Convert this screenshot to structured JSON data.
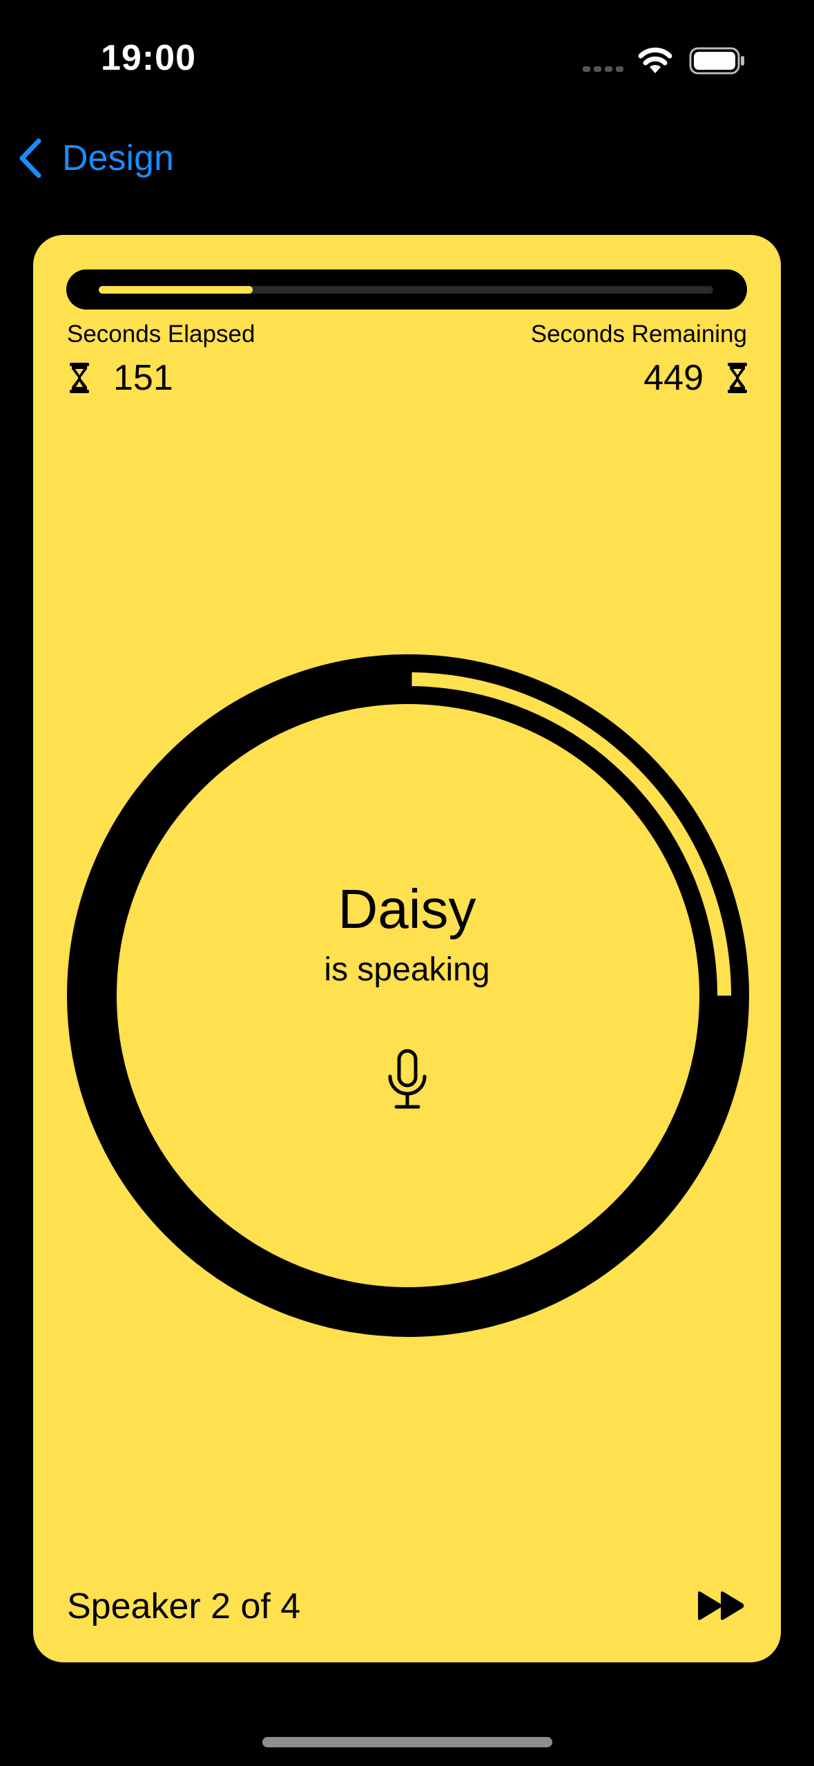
{
  "status_bar": {
    "time": "19:00"
  },
  "nav": {
    "back_label": "Design"
  },
  "timer": {
    "elapsed_label": "Seconds Elapsed",
    "remaining_label": "Seconds Remaining",
    "elapsed": "151",
    "remaining": "449",
    "progress_fraction": 0.25
  },
  "speaker": {
    "name": "Daisy",
    "status": "is speaking",
    "count_text": "Speaker 2 of 4",
    "segment_completed_fraction": 0.25
  },
  "icons": {
    "back": "chevron-left-icon",
    "hourglass": "hourglass-icon",
    "microphone": "mic-icon",
    "skip": "forward-fill-icon",
    "wifi": "wifi-icon",
    "battery": "battery-icon"
  },
  "colors": {
    "background": "#000000",
    "card": "#FFE04F",
    "accent": "#1A8CFF",
    "ink": "#000000"
  }
}
